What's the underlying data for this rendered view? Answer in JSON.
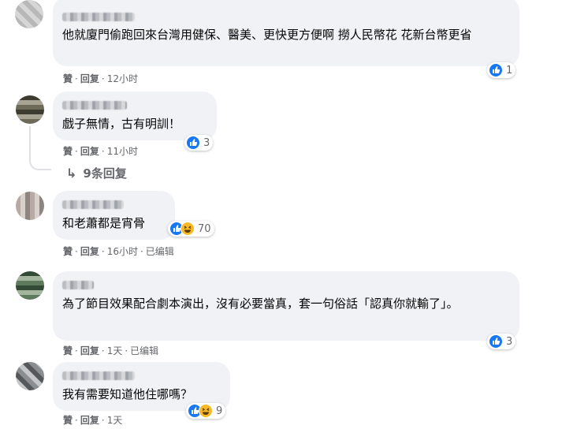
{
  "comments": [
    {
      "text": "他就廈門偷跑回來台灣用健保、醫美、更快更方便啊 撈人民幣花 花新台幣更省",
      "like_label": "贊",
      "reply_label": "回复",
      "time": "12小时",
      "edited": "",
      "reaction_count": "1",
      "reactions": [
        "like"
      ]
    },
    {
      "text": "戲子無情，古有明訓！",
      "like_label": "贊",
      "reply_label": "回复",
      "time": "11小时",
      "edited": "",
      "reaction_count": "3",
      "reactions": [
        "like"
      ]
    },
    {
      "text": "和老蕭都是宵骨",
      "like_label": "贊",
      "reply_label": "回复",
      "time": "16小时",
      "edited": "已编辑",
      "reaction_count": "70",
      "reactions": [
        "like",
        "haha"
      ]
    },
    {
      "text": "為了節目效果配合劇本演出，沒有必要當真，套一句俗話「認真你就輸了」。",
      "like_label": "贊",
      "reply_label": "回复",
      "time": "1天",
      "edited": "已编辑",
      "reaction_count": "3",
      "reactions": [
        "like"
      ]
    },
    {
      "text": "我有需要知道他住哪嗎？",
      "like_label": "贊",
      "reply_label": "回复",
      "time": "1天",
      "edited": "",
      "reaction_count": "9",
      "reactions": [
        "like",
        "haha"
      ]
    }
  ],
  "view_replies": "9条回复",
  "separator": "·",
  "colors": {
    "bubble": "#f0f2f5",
    "meta_text": "#65676b",
    "like_blue": "#1877f2",
    "haha_yellow": "#f7b928"
  }
}
